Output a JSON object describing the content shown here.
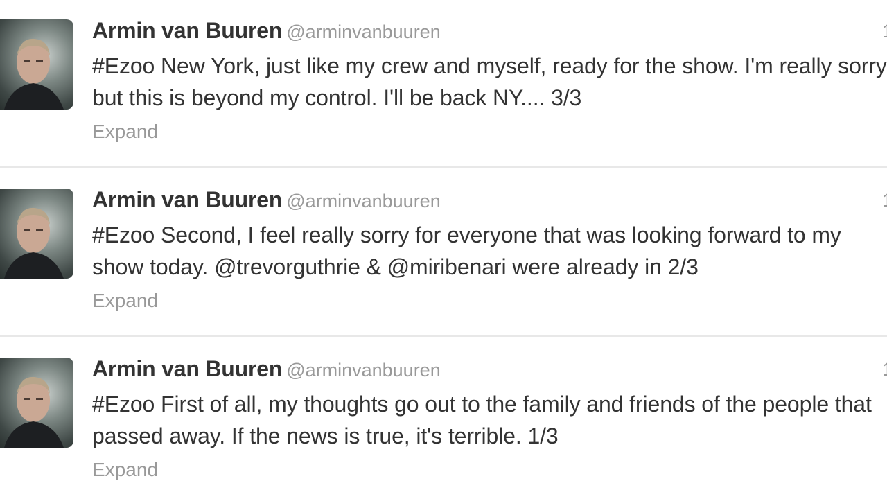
{
  "tweets": [
    {
      "fullname": "Armin van Buuren",
      "username": "@arminvanbuuren",
      "time": "1",
      "text": "#Ezoo New York, just like my crew and myself, ready for the show. I'm really sorry but this is beyond my control. I'll be back NY.... 3/3",
      "expand_label": "Expand"
    },
    {
      "fullname": "Armin van Buuren",
      "username": "@arminvanbuuren",
      "time": "1",
      "text": "#Ezoo Second, I feel really sorry for everyone that was looking forward to my show today. @trevorguthrie & @miribenari were already in 2/3",
      "expand_label": "Expand"
    },
    {
      "fullname": "Armin van Buuren",
      "username": "@arminvanbuuren",
      "time": "1",
      "text": "#Ezoo First of all, my thoughts go out to the family and friends of the people that passed away. If the news is true, it's terrible. 1/3",
      "expand_label": "Expand"
    }
  ]
}
